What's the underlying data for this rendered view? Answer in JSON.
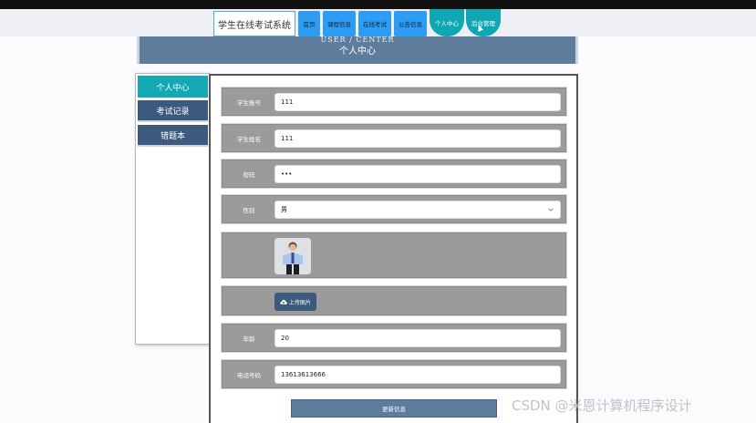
{
  "header": {
    "brand": "学生在线考试系统",
    "nav": [
      {
        "label": "首页"
      },
      {
        "label": "课程信息"
      },
      {
        "label": "在线考试"
      },
      {
        "label": "公告信息"
      },
      {
        "label": "个人中心"
      },
      {
        "label": "后台管理"
      }
    ]
  },
  "banner": {
    "subtitle_en": "USER / CENTER",
    "title": "个人中心"
  },
  "sidebar": {
    "items": [
      {
        "label": "个人中心",
        "active": true
      },
      {
        "label": "考试记录",
        "active": false
      },
      {
        "label": "错题本",
        "active": false
      }
    ]
  },
  "form": {
    "account": {
      "label": "学生账号",
      "value": "111"
    },
    "name": {
      "label": "学生姓名",
      "value": "111"
    },
    "password": {
      "label": "密码",
      "value": "•••"
    },
    "gender": {
      "label": "性别",
      "value": "男"
    },
    "upload_label": "上传图片",
    "age": {
      "label": "年龄",
      "value": "20"
    },
    "phone": {
      "label": "电话号码",
      "value": "13613613666"
    },
    "submit_label": "更新信息"
  },
  "watermark": "CSDN @米恩计算机程序设计",
  "colors": {
    "accent": "#12a9b4",
    "nav_blue": "#2e9cf2",
    "navy": "#3b5a7e",
    "banner": "#5e7d9c",
    "row_gray": "#9b9b9b"
  }
}
